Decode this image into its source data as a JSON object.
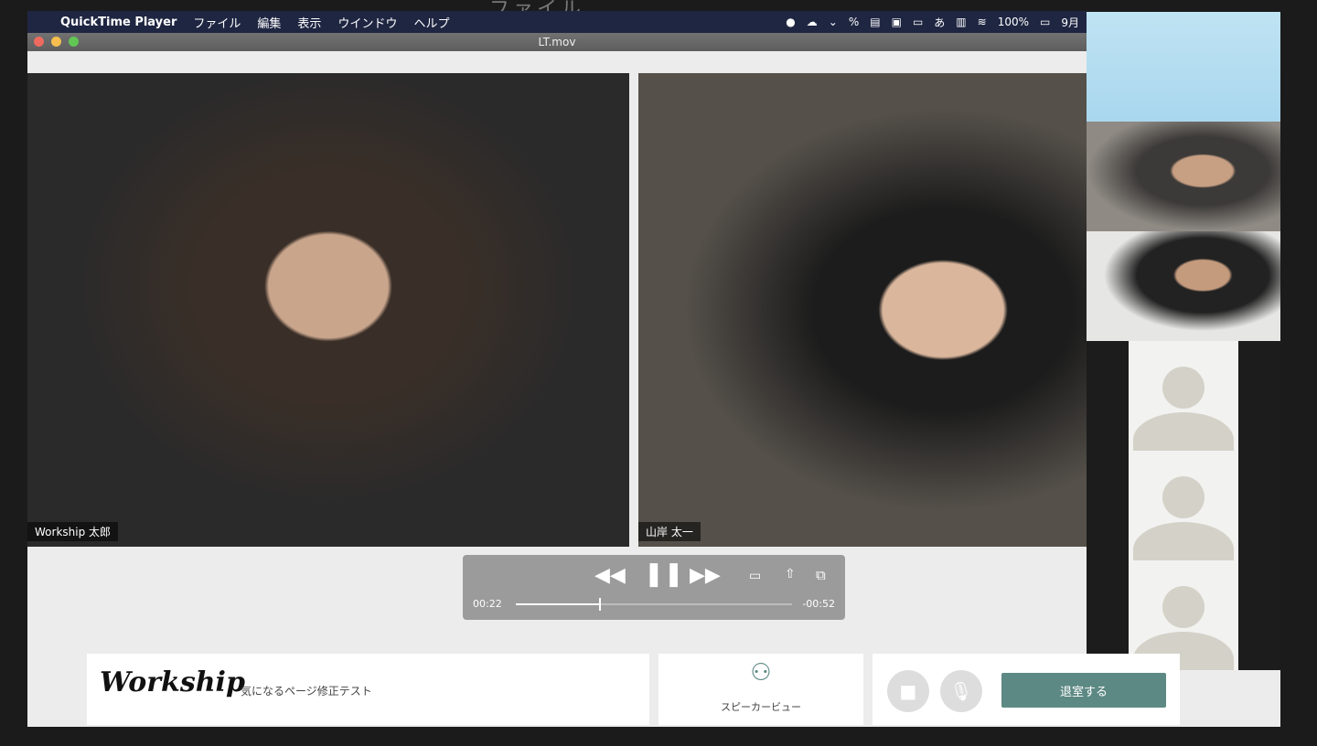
{
  "ghost_text": "ファイル",
  "menubar": {
    "apple": "",
    "app": "QuickTime Player",
    "items": [
      "ファイル",
      "編集",
      "表示",
      "ウインドウ",
      "ヘルプ"
    ],
    "battery": "100%",
    "clock": "9月"
  },
  "window": {
    "title": "LT.mov"
  },
  "videos": {
    "left_name": "Workship 太郎",
    "right_name": "山岸 太一"
  },
  "player": {
    "elapsed": "00:22",
    "remaining": "-00:52",
    "progress": 0.3
  },
  "bottom": {
    "logo": "Workship",
    "page_title": "気になるページ修正テスト",
    "speaker_view": "スピーカービュー",
    "leave": "退室する"
  },
  "colors": {
    "accent": "#5d8984",
    "menubar": "#1f2642"
  }
}
